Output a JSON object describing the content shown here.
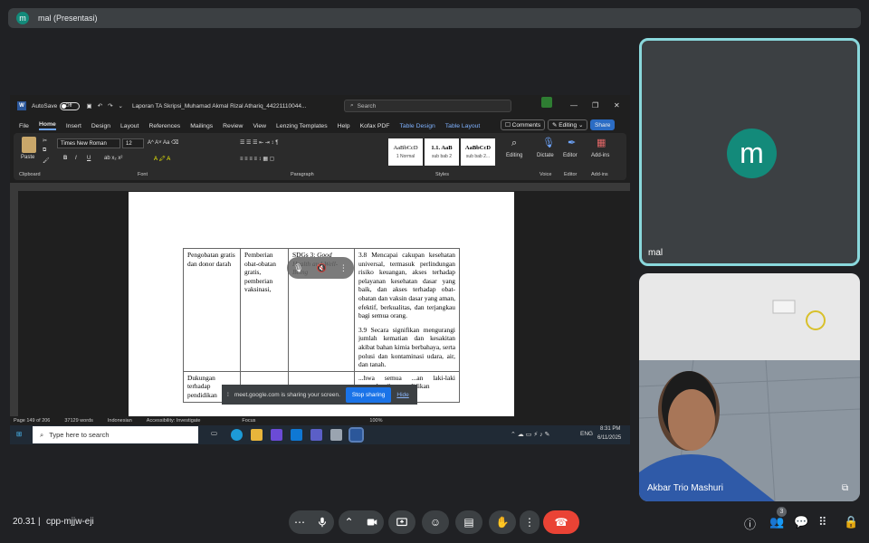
{
  "presenter_bar": {
    "avatar": "m",
    "label": "mal (Presentasi)"
  },
  "word": {
    "autosave_label": "AutoSave",
    "autosave_state": "Off",
    "doc_title": "Laporan TA Skripsi_Muhamad Akmal Rizal Athariq_44221110044...",
    "search_placeholder": "Search",
    "menu": [
      "File",
      "Home",
      "Insert",
      "Design",
      "Layout",
      "References",
      "Mailings",
      "Review",
      "View",
      "Lenzing Templates",
      "Help",
      "Kofax PDF",
      "Table Design",
      "Table Layout"
    ],
    "comments_label": "Comments",
    "editing_label": "Editing",
    "share_label": "Share",
    "ribbon": {
      "paste": "Paste",
      "clipboard": "Clipboard",
      "font_name": "Times New Roman",
      "font_size": "12",
      "font_group": "Font",
      "paragraph_group": "Paragraph",
      "styles_group": "Styles",
      "styles": [
        {
          "preview": "AaBbCcD",
          "name": "1 Normal"
        },
        {
          "preview": "1.1. AaB",
          "name": "sub bab 2"
        },
        {
          "preview": "AaBbCcD",
          "name": "sub bab 2..."
        }
      ],
      "editing": "Editing",
      "dictate": "Dictate",
      "voice": "Voice",
      "editor": "Editor",
      "editor_group": "Editor",
      "addins": "Add-ins",
      "addins_group": "Add-ins"
    },
    "table": {
      "row1": {
        "c1": "Pengobatan gratis dan donor darah",
        "c2": "Pemberian obat-obatan gratis, pemberian vaksinasi,",
        "c3_prefix": "SDGs 3: ",
        "c3_italic": "Good Health and Well-Being",
        "c4_p1": "3.8 Mencapai cakupan kesehatan universal, termasuk perlindungan risiko keuangan, akses terhadap pelayanan kesehatan dasar yang baik, dan akses terhadap obat- obatan dan vaksin dasar yang aman, efektif, berkualitas, dan terjangkau bagi semua orang.",
        "c4_p2": "3.9 Secara signifikan mengurangi jumlah kematian dan kesakitan akibat bahan kimia berbahaya, serta polusi dan kontaminasi udara, air, dan tanah."
      },
      "row2": {
        "c1": "Dukungan terhadap pendidikan",
        "c4": "...hwa semua ...an laki-laki menyelesaikan pendidikan"
      }
    },
    "share_banner": {
      "text": "meet.google.com is sharing your screen.",
      "stop": "Stop sharing",
      "hide": "Hide"
    },
    "status": {
      "page": "Page 149 of 206",
      "words": "37129 words",
      "language": "Indonesian",
      "accessibility": "Accessibility: Investigate",
      "focus": "Focus",
      "zoom": "100%"
    }
  },
  "taskbar": {
    "search_placeholder": "Type here to search",
    "lang": "ENG",
    "time": "8:31 PM",
    "date": "6/11/2025"
  },
  "tiles": {
    "mal": {
      "avatar": "m",
      "name": "mal"
    },
    "akbar": {
      "name": "Akbar Trio Mashuri"
    }
  },
  "bottom": {
    "time": "20.31",
    "separator": "|",
    "meeting_code": "cpp-mjjw-eji",
    "people_count": "3"
  },
  "colors": {
    "accent_teal": "#8ad8dc",
    "avatar_bg": "#138a7a",
    "end_call": "#ea4335",
    "share_blue": "#1a73e8"
  }
}
